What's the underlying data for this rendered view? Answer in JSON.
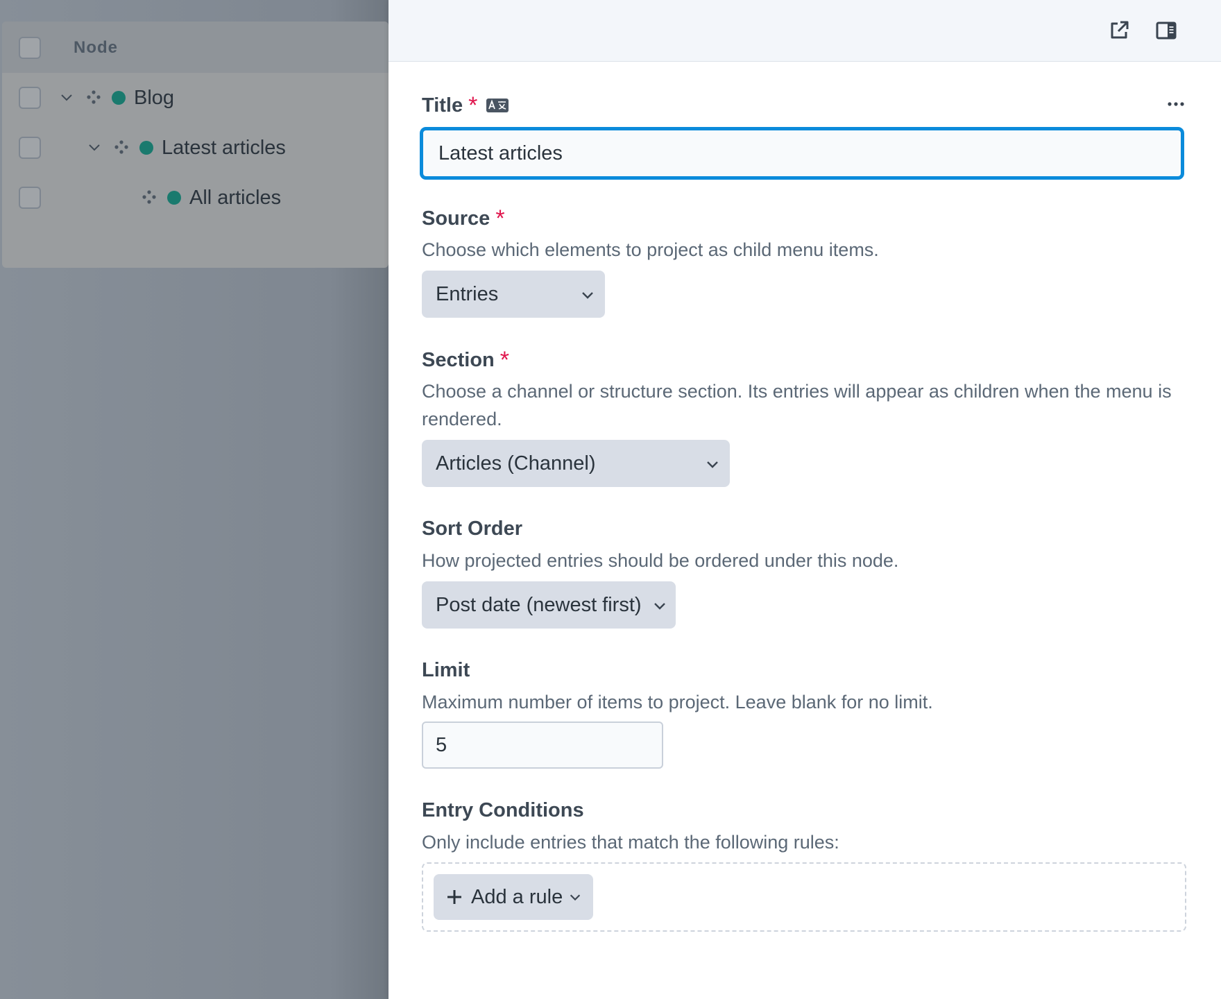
{
  "tree": {
    "column_header": "Node",
    "nodes": [
      {
        "label": "Blog",
        "status_color": "#1a7a6e",
        "expanded": true
      },
      {
        "label": "Latest articles",
        "status_color": "#1a7a6e",
        "expanded": true
      },
      {
        "label": "All articles",
        "status_color": "#1a7a6e",
        "expanded": false
      }
    ]
  },
  "panel": {
    "header_icons": [
      "open-in-new-window-icon",
      "sidebar-toggle-icon"
    ],
    "fields": {
      "title": {
        "label": "Title",
        "required_mark": "*",
        "value": "Latest articles"
      },
      "source": {
        "label": "Source",
        "required_mark": "*",
        "description": "Choose which elements to project as child menu items.",
        "selected": "Entries"
      },
      "section": {
        "label": "Section",
        "required_mark": "*",
        "description": "Choose a channel or structure section. Its entries will appear as children when the menu is rendered.",
        "selected": "Articles (Channel)"
      },
      "sort_order": {
        "label": "Sort Order",
        "description": "How projected entries should be ordered under this node.",
        "selected": "Post date (newest first)"
      },
      "limit": {
        "label": "Limit",
        "description": "Maximum number of items to project. Leave blank for no limit.",
        "value": "5"
      },
      "entry_conditions": {
        "label": "Entry Conditions",
        "description": "Only include entries that match the following rules:",
        "add_rule_label": "Add a rule"
      }
    }
  },
  "colors": {
    "accent_focus": "#0b8bdb",
    "required": "#e0164d",
    "status_enabled": "#1a7a6e"
  }
}
